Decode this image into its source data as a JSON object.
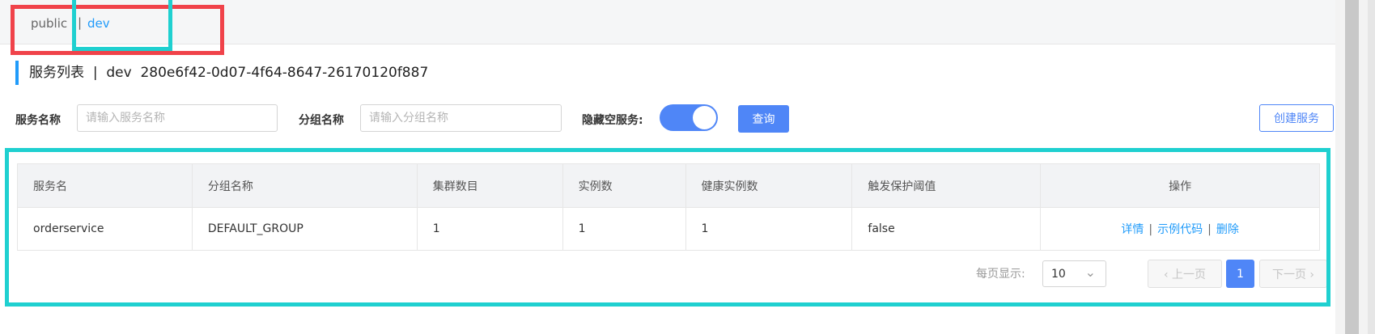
{
  "namespace_bar": {
    "public": "public",
    "separator": "|",
    "dev": "dev"
  },
  "title": {
    "heading": "服务列表",
    "separator": "|",
    "namespace": "dev",
    "namespace_id": "280e6f42-0d07-4f64-8647-26170120f887"
  },
  "filters": {
    "service_label": "服务名称",
    "service_placeholder": "请输入服务名称",
    "group_label": "分组名称",
    "group_placeholder": "请输入分组名称",
    "hide_empty_label": "隐藏空服务:",
    "hide_empty_on": true,
    "query_button": "查询",
    "create_button": "创建服务"
  },
  "table": {
    "headers": [
      "服务名",
      "分组名称",
      "集群数目",
      "实例数",
      "健康实例数",
      "触发保护阈值",
      "操作"
    ],
    "rows": [
      {
        "service": "orderservice",
        "group": "DEFAULT_GROUP",
        "clusters": "1",
        "instances": "1",
        "healthy": "1",
        "protect": "false",
        "ops": {
          "detail": "详情",
          "sep": "|",
          "sample": "示例代码",
          "delete": "删除"
        }
      }
    ]
  },
  "pagination": {
    "page_size_label": "每页显示:",
    "page_size": "10",
    "prev": "上一页",
    "current": "1",
    "next": "下一页"
  },
  "colors": {
    "accent": "#4f86f7",
    "link": "#209bfa",
    "highlight_red": "#f0434a",
    "highlight_cyan": "#1fd0d0"
  }
}
